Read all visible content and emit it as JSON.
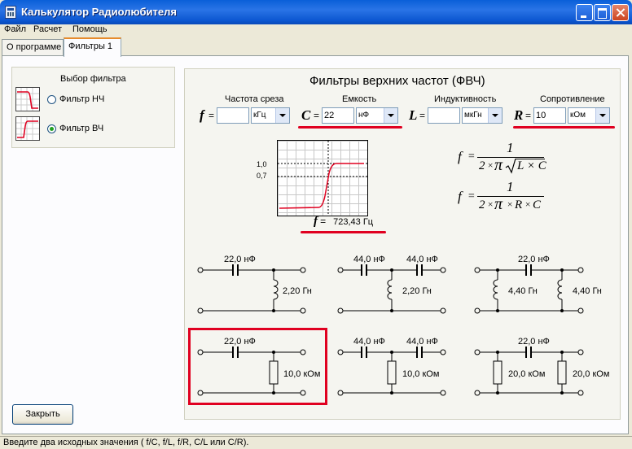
{
  "window": {
    "title": "Калькулятор Радиолюбителя"
  },
  "menu": {
    "file": "Файл",
    "calc": "Расчет",
    "help": "Помощь"
  },
  "tabs": {
    "about": "О программе",
    "filters": "Фильтры 1"
  },
  "filter_select": {
    "title": "Выбор фильтра",
    "lowpass": "Фильтр НЧ",
    "highpass": "Фильтр ВЧ",
    "selected": "highpass"
  },
  "panel": {
    "title": "Фильтры верхних частот (ФВЧ)",
    "fields": {
      "freq": {
        "label": "Частота среза",
        "symbol": "f",
        "eq": "=",
        "value": "",
        "unit": "кГц"
      },
      "cap": {
        "label": "Емкость",
        "symbol": "C",
        "eq": "=",
        "value": "22",
        "unit": "нФ"
      },
      "ind": {
        "label": "Индуктивность",
        "symbol": "L",
        "eq": "=",
        "value": "",
        "unit": "мкГн"
      },
      "res": {
        "label": "Сопротивление",
        "symbol": "R",
        "eq": "=",
        "value": "10",
        "unit": "кОм"
      }
    },
    "graph": {
      "y_high": "1,0",
      "y_mid": "0,7"
    },
    "result": {
      "symbol": "f",
      "eq": "=",
      "value": "723,43 Гц"
    },
    "formulas": {
      "f": "f",
      "eq": "=",
      "one": "1",
      "two": "2",
      "times": "×",
      "pi": "π",
      "lc": "L × C",
      "r": "R",
      "c": "C"
    }
  },
  "circuits": {
    "lc1": {
      "cap": "22,0 нФ",
      "ind": "2,20 Гн"
    },
    "lc2": {
      "cap1": "44,0 нФ",
      "cap2": "44,0 нФ",
      "ind": "2,20 Гн"
    },
    "lc3": {
      "cap": "22,0 нФ",
      "ind1": "4,40 Гн",
      "ind2": "4,40 Гн"
    },
    "rc1": {
      "cap": "22,0 нФ",
      "res": "10,0 кОм"
    },
    "rc2": {
      "cap1": "44,0 нФ",
      "cap2": "44,0 нФ",
      "res": "10,0 кОм"
    },
    "rc3": {
      "cap": "22,0 нФ",
      "res1": "20,0 кОм",
      "res2": "20,0 кОм"
    }
  },
  "buttons": {
    "close": "Закрыть"
  },
  "status": "Введите два исходных значения ( f/C, f/L, f/R, C/L или C/R).",
  "colors": {
    "accent_red": "#e00020",
    "titlebar_blue": "#0a5fd8",
    "curve_red": "#e00020"
  }
}
